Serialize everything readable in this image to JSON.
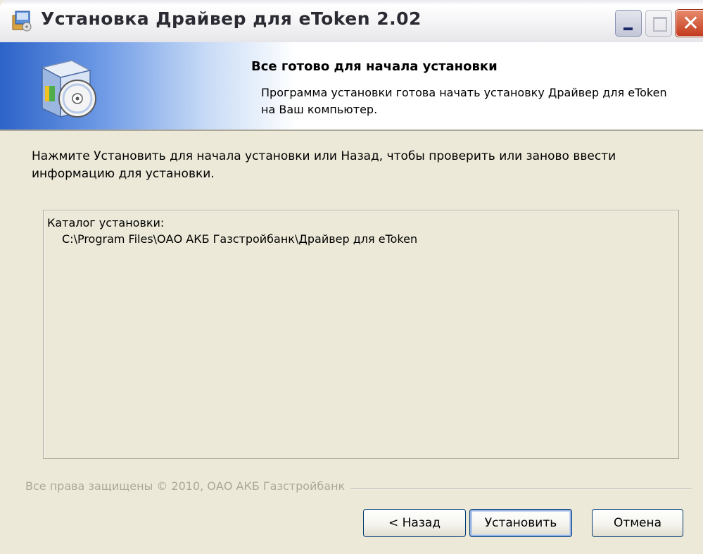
{
  "window": {
    "title": "Установка Драйвер для eToken 2.02",
    "controls": {
      "minimize_icon": "minimize-icon",
      "maximize_icon": "maximize-icon",
      "close_icon": "close-icon",
      "close_glyph": "✕"
    }
  },
  "banner": {
    "heading": "Все готово для начала установки",
    "description": "Программа установки готова начать установку Драйвер для eToken на Ваш компьютер.",
    "art_icon": "installer-box-cd-icon"
  },
  "body": {
    "instructions": "Нажмите Установить для начала установки или Назад, чтобы проверить или заново ввести информацию для установки.",
    "summary": {
      "label": "Каталог установки:",
      "value": "C:\\Program Files\\ОАО АКБ Газстройбанк\\Драйвер для eToken"
    }
  },
  "footer": {
    "copyright": "Все права защищены © 2010, ОАО АКБ Газстройбанк",
    "buttons": {
      "back": "< Назад",
      "install": "Установить",
      "cancel": "Отмена"
    }
  },
  "colors": {
    "dialog_bg": "#ece9d8",
    "banner_gradient_start": "#2d63c8",
    "disabled_text": "#aca899",
    "button_border": "#003c74",
    "close_button": "#c33b1e"
  }
}
